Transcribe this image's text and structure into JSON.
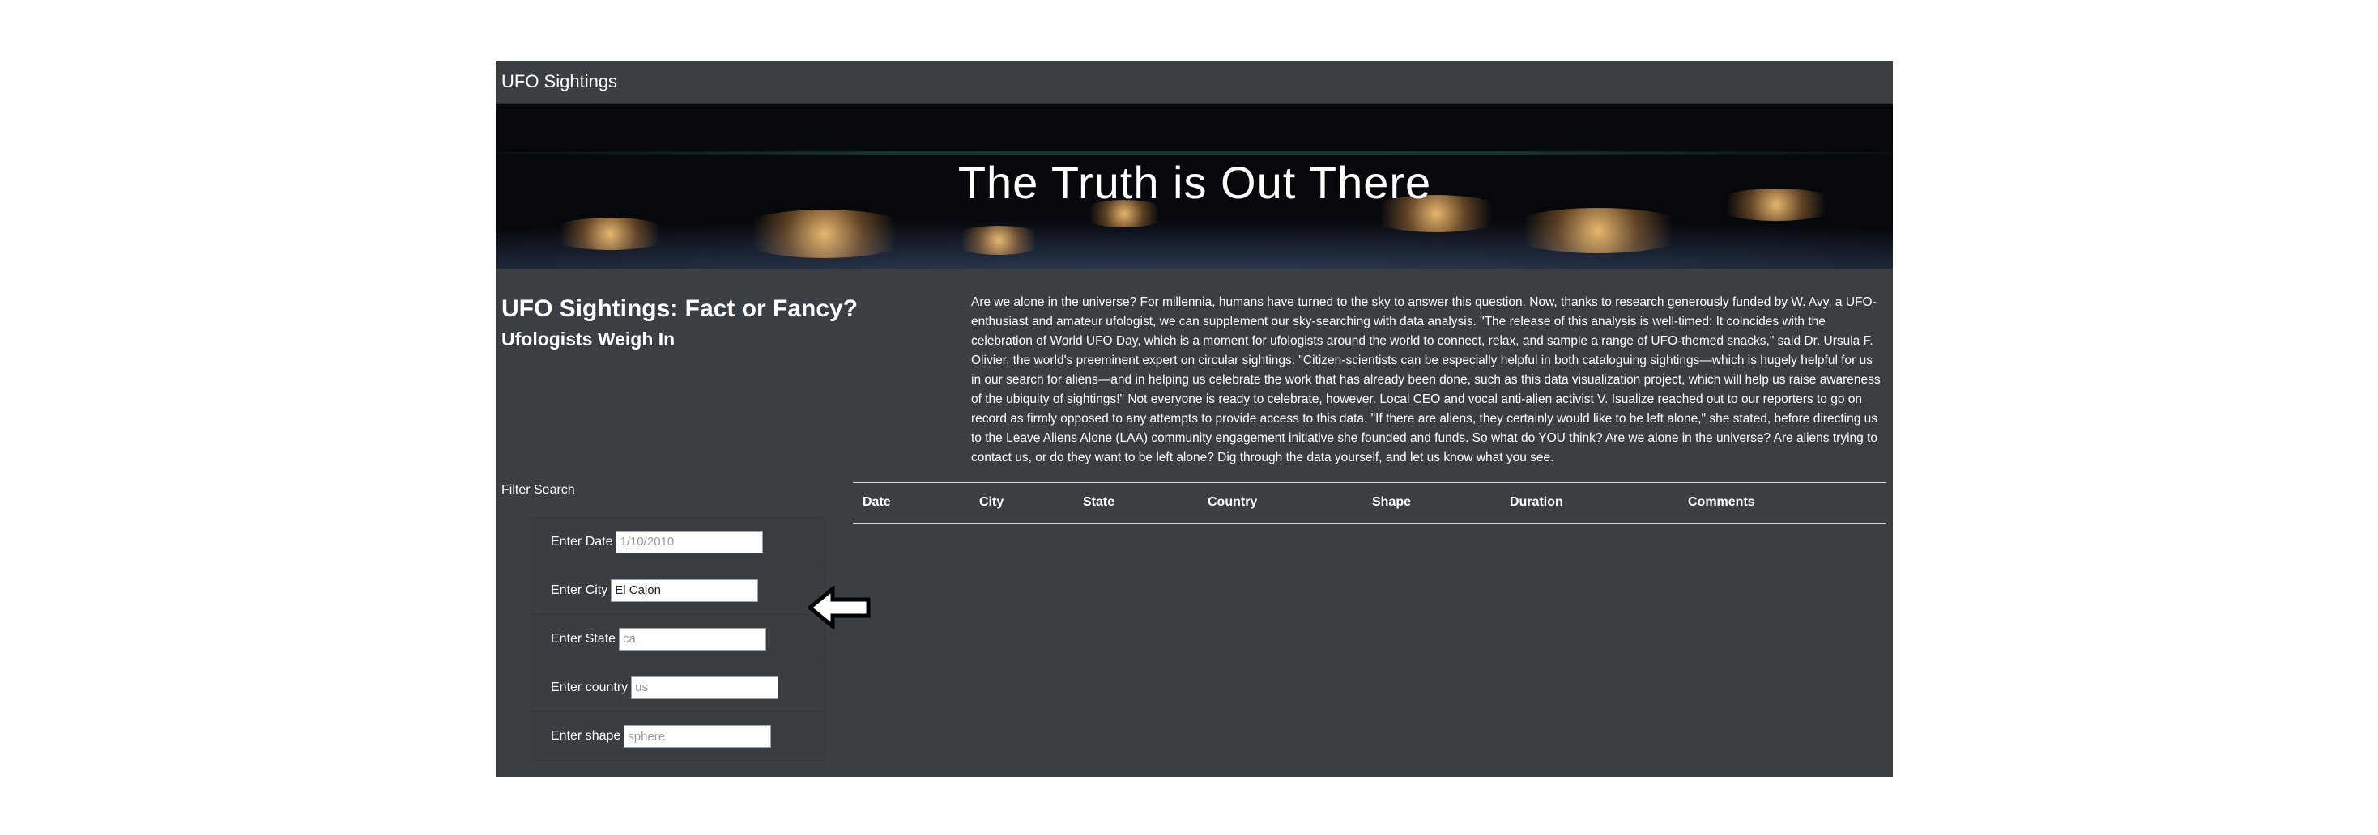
{
  "navbar": {
    "brand": "UFO Sightings"
  },
  "hero": {
    "title": "The Truth is Out There"
  },
  "article": {
    "heading_strong": "UFO Sightings: Fact or Fancy?",
    "heading_small": "Ufologists Weigh In",
    "body": "Are we alone in the universe? For millennia, humans have turned to the sky to answer this question. Now, thanks to research generously funded by W. Avy, a UFO-enthusiast and amateur ufologist, we can supplement our sky-searching with data analysis. \"The release of this analysis is well-timed: It coincides with the celebration of World UFO Day, which is a moment for ufologists around the world to connect, relax, and sample a range of UFO-themed snacks,\" said Dr. Ursula F. Olivier, the world's preeminent expert on circular sightings. \"Citizen-scientists can be especially helpful in both cataloguing sightings—which is hugely helpful for us in our search for aliens—and in helping us celebrate the work that has already been done, such as this data visualization project, which will help us raise awareness of the ubiquity of sightings!\" Not everyone is ready to celebrate, however. Local CEO and vocal anti-alien activist V. Isualize reached out to our reporters to go on record as firmly opposed to any attempts to provide access to this data. \"If there are aliens, they certainly would like to be left alone,\" she stated, before directing us to the Leave Aliens Alone (LAA) community engagement initiative she founded and funds. So what do YOU think? Are we alone in the universe? Are aliens trying to contact us, or do they want to be left alone? Dig through the data yourself, and let us know what you see."
  },
  "filters": {
    "title": "Filter Search",
    "date": {
      "label": "Enter Date",
      "placeholder": "1/10/2010",
      "value": ""
    },
    "city": {
      "label": "Enter City",
      "placeholder": "",
      "value": "El Cajon"
    },
    "state": {
      "label": "Enter State",
      "placeholder": "ca",
      "value": ""
    },
    "country": {
      "label": "Enter country",
      "placeholder": "us",
      "value": ""
    },
    "shape": {
      "label": "Enter shape",
      "placeholder": "sphere",
      "value": ""
    }
  },
  "table": {
    "columns": [
      "Date",
      "City",
      "State",
      "Country",
      "Shape",
      "Duration",
      "Comments"
    ]
  },
  "icons": {
    "pointer": "left-arrow-icon"
  },
  "colors": {
    "background": "#3a3f44",
    "text": "#ffffff",
    "rule": "#d9d9d9"
  }
}
